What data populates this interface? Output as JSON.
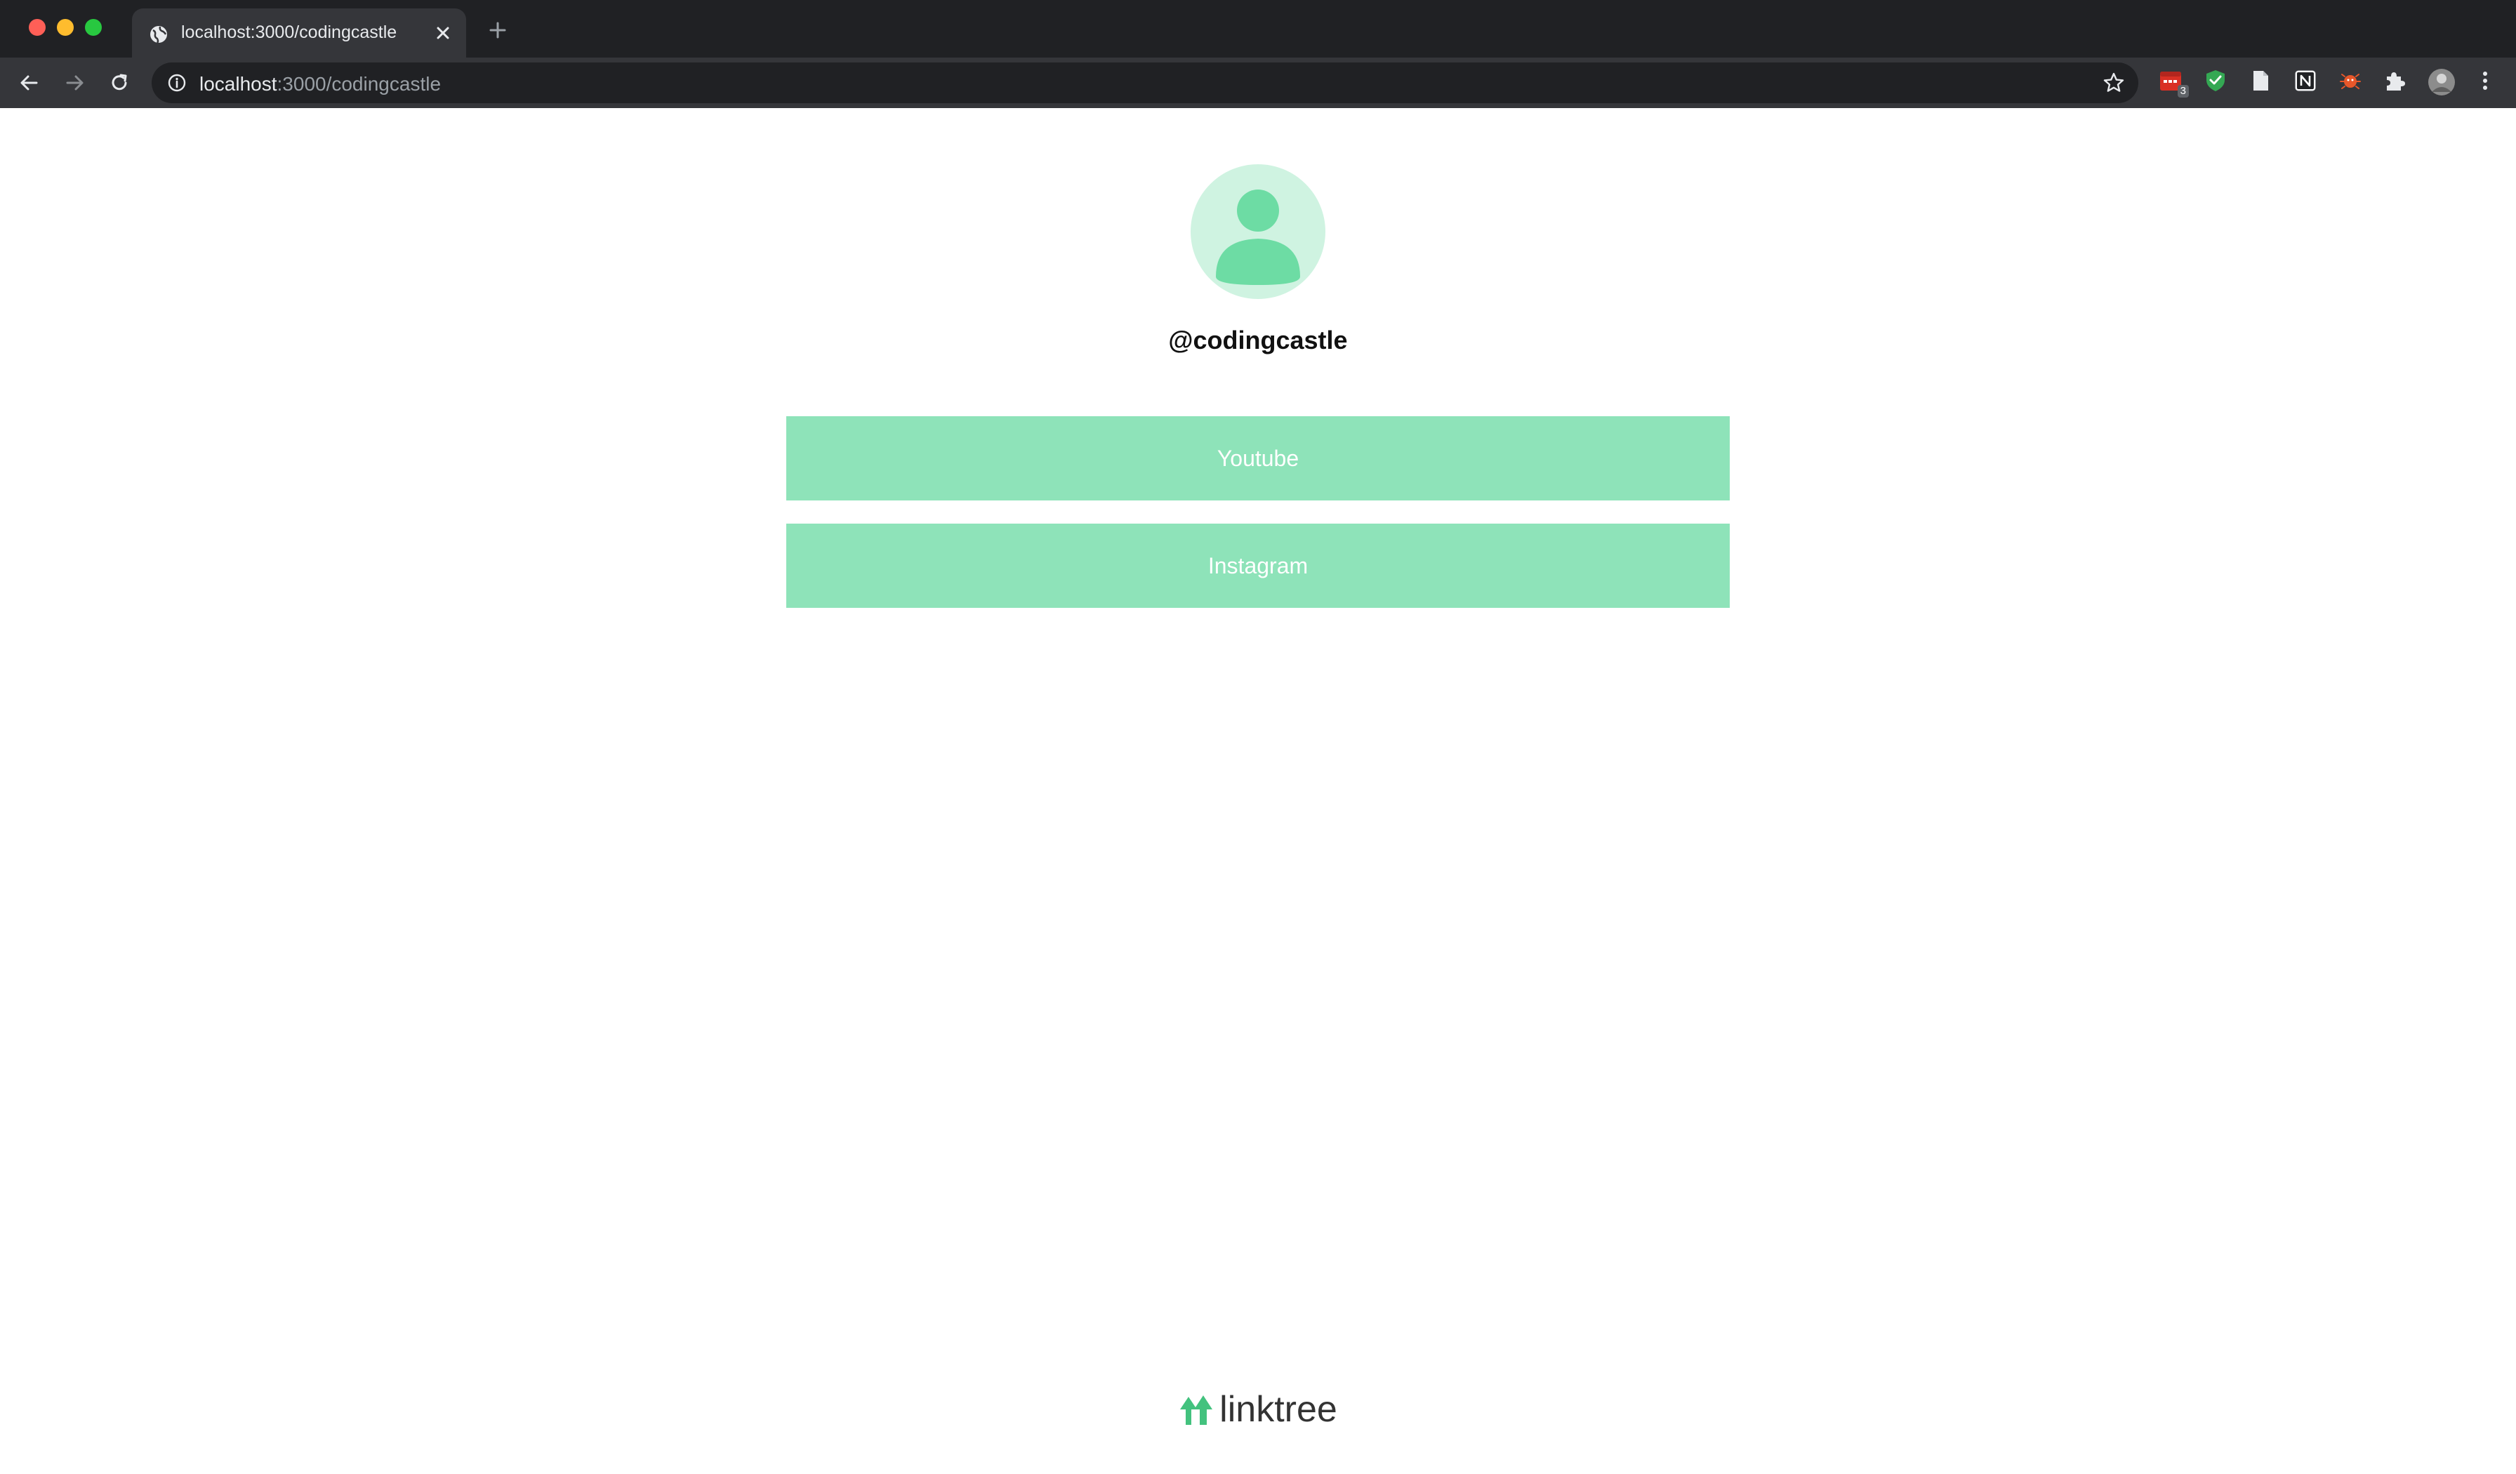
{
  "browser": {
    "tab": {
      "title": "localhost:3000/codingcastle",
      "favicon": "globe-icon",
      "close_icon": "close-icon"
    },
    "new_tab_icon": "plus-icon",
    "toolbar": {
      "back_icon": "arrow-left-icon",
      "forward_icon": "arrow-right-icon",
      "reload_icon": "reload-icon",
      "address": {
        "info_icon": "info-icon",
        "host": "localhost",
        "path": ":3000/codingcastle",
        "bookmark_icon": "star-icon"
      },
      "extensions": [
        {
          "name": "calendar-extension-icon",
          "badge": "3"
        },
        {
          "name": "shield-extension-icon"
        },
        {
          "name": "document-extension-icon"
        },
        {
          "name": "notion-extension-icon"
        },
        {
          "name": "bug-extension-icon"
        },
        {
          "name": "puzzle-extensions-icon"
        },
        {
          "name": "profile-avatar-icon"
        },
        {
          "name": "more-menu-icon"
        }
      ]
    }
  },
  "page": {
    "avatar_icon": "user-icon",
    "username": "@codingcastle",
    "links": [
      {
        "label": "Youtube"
      },
      {
        "label": "Instagram"
      }
    ],
    "footer": {
      "logo_icon": "linktree-logo-icon",
      "brand": "linktree"
    }
  },
  "colors": {
    "accent": "#8ee3b9",
    "avatar_bg": "#cff3e1",
    "avatar_fg": "#6ddca4",
    "tab_bar": "#202124",
    "toolbar": "#35363a"
  }
}
